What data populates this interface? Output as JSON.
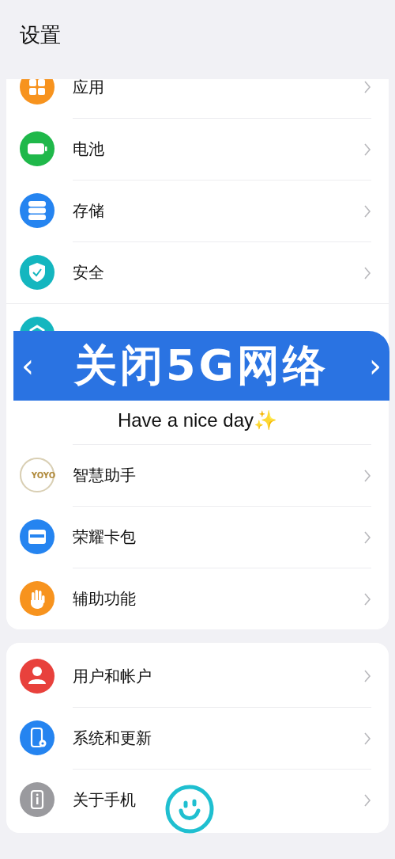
{
  "title": "设置",
  "sections": [
    {
      "items": [
        {
          "label": "应用",
          "color": "#f7931e"
        },
        {
          "label": "电池",
          "color": "#1fb84a"
        },
        {
          "label": "存储",
          "color": "#2584f0"
        },
        {
          "label": "安全",
          "color": "#14b6bf"
        },
        {
          "color": "#14b6bf"
        },
        {
          "label": "智慧助手",
          "color": "#e9e4d4"
        },
        {
          "label": "荣耀卡包",
          "color": "#2584f0"
        },
        {
          "label": "辅助功能",
          "color": "#f7931e"
        }
      ]
    },
    {
      "items": [
        {
          "label": "用户和帐户",
          "color": "#e8413c"
        },
        {
          "label": "系统和更新",
          "color": "#2584f0"
        },
        {
          "label": "关于手机",
          "color": "#9a9a9e"
        }
      ]
    }
  ],
  "banner": {
    "prev": "‹",
    "title": "关闭5G网络",
    "next": "›"
  },
  "caption": "Have a nice day✨",
  "logo_text": "YOYO"
}
